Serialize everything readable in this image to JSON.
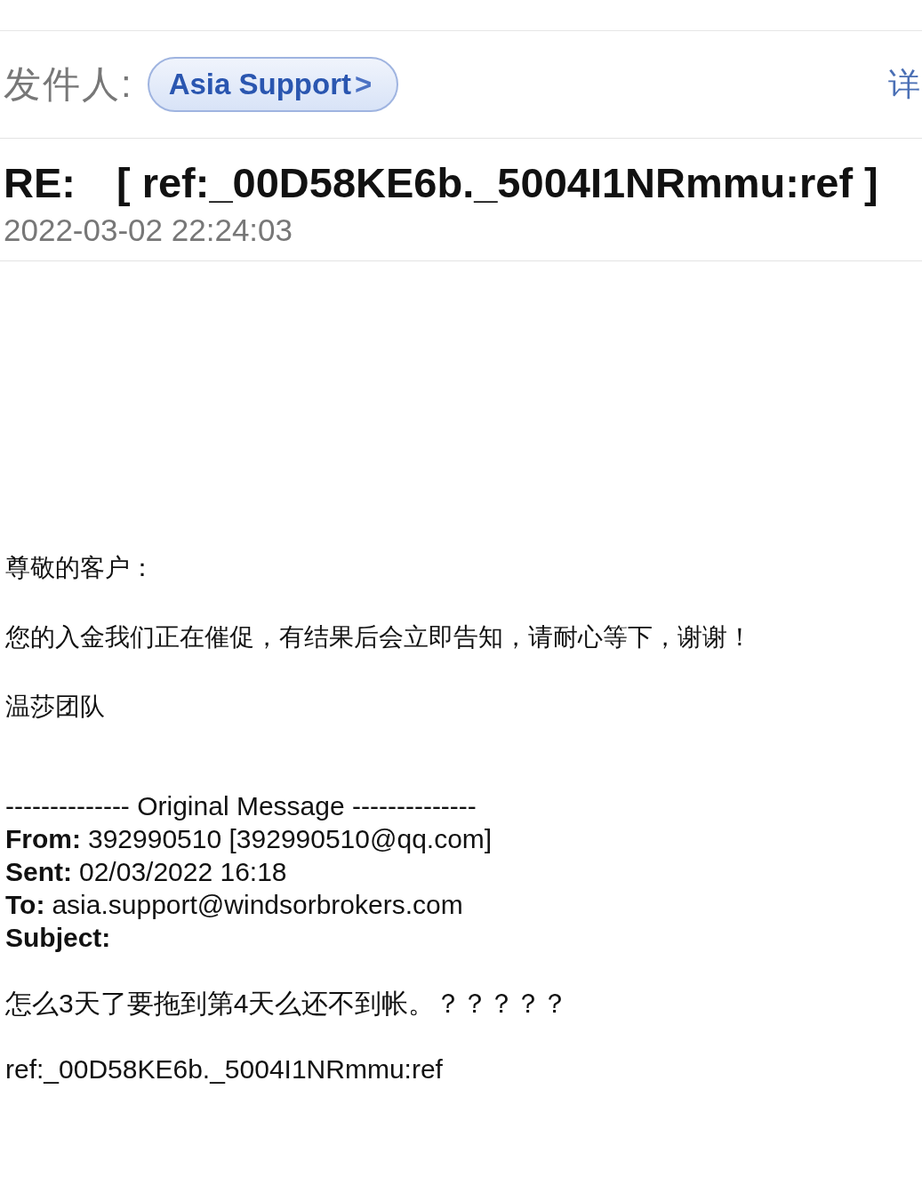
{
  "sender": {
    "label": "发件人:",
    "name": "Asia Support",
    "chevron": ">",
    "details_link": "详"
  },
  "subject": {
    "prefix": "RE:",
    "text": "[ ref:_00D58KE6b._5004I1NRmmu:ref ]"
  },
  "date": "2022-03-02 22:24:03",
  "body": [
    "尊敬的客户：",
    "您的入金我们正在催促，有结果后会立即告知，请耐心等下，谢谢！",
    "温莎团队"
  ],
  "original_message": {
    "separator": "-------------- Original Message --------------",
    "fields": [
      {
        "label": "From:",
        "value": "392990510 [392990510@qq.com]"
      },
      {
        "label": "Sent:",
        "value": "02/03/2022 16:18"
      },
      {
        "label": "To:",
        "value": "asia.support@windsorbrokers.com"
      },
      {
        "label": "Subject:"
      }
    ],
    "body": [
      "怎么3天了要拖到第4天么还不到帐。？？？？？",
      "ref:_00D58KE6b._5004I1NRmmu:ref"
    ]
  }
}
